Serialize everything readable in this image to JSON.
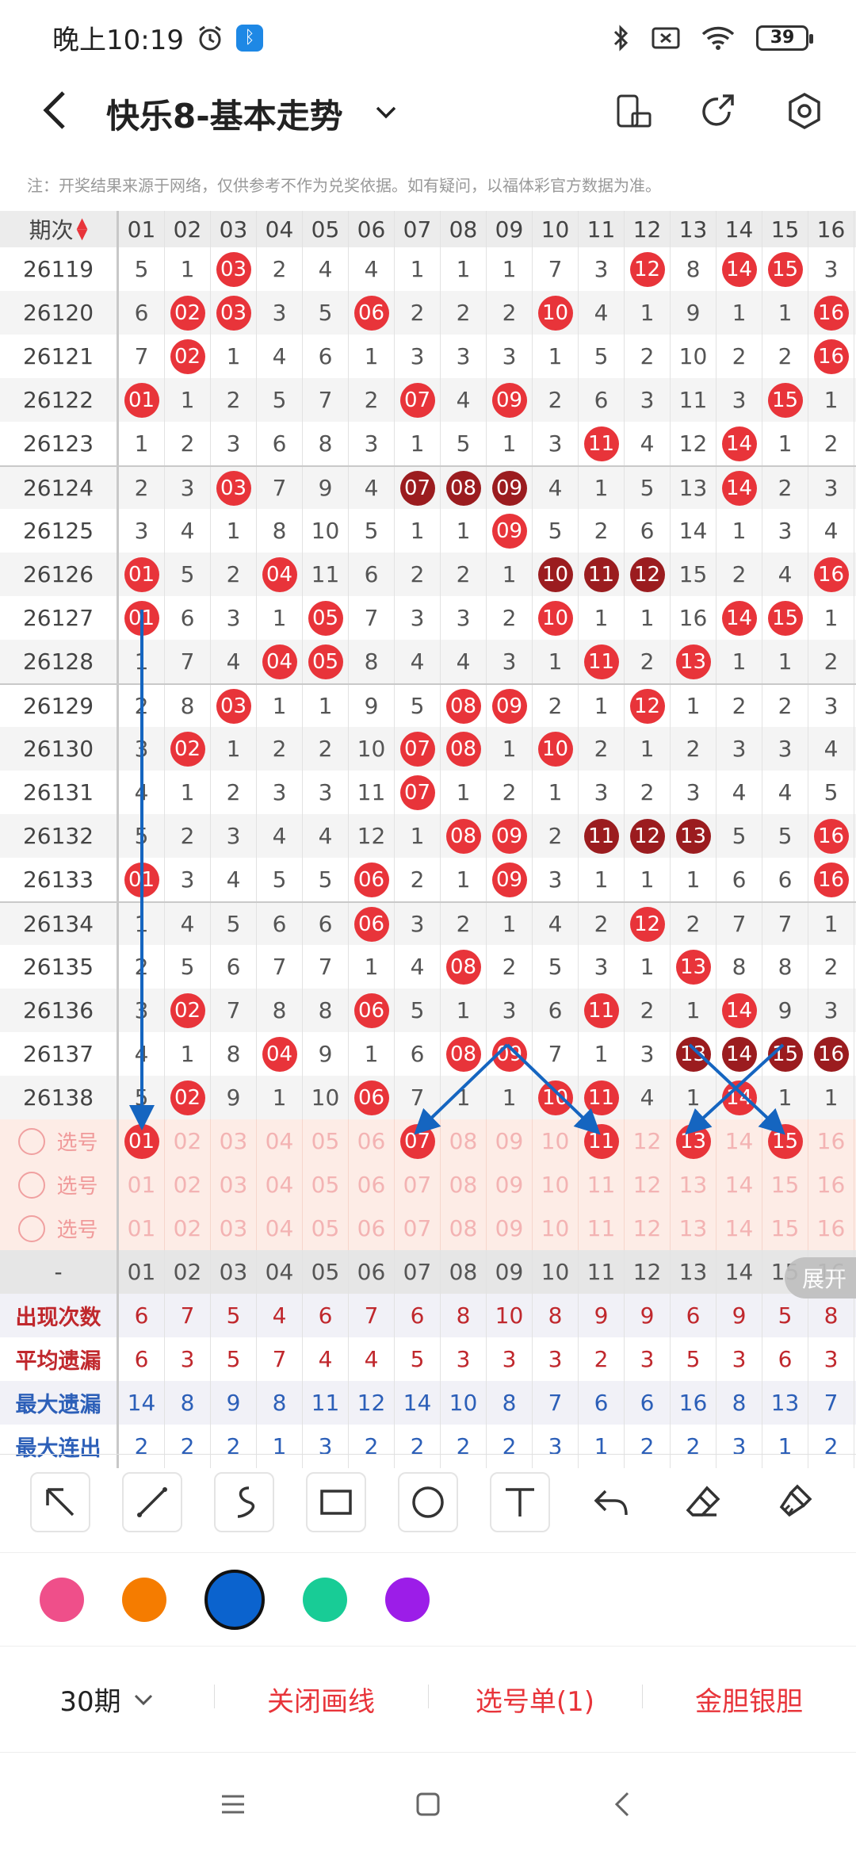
{
  "status": {
    "time": "晚上10:19",
    "battery": "39"
  },
  "header": {
    "title": "快乐8-基本走势"
  },
  "disclaimer": "注：开奖结果来源于网络，仅供参考不作为兑奖依据。如有疑问，以福体彩官方数据为准。",
  "table": {
    "period_label": "期次",
    "columns": [
      "01",
      "02",
      "03",
      "04",
      "05",
      "06",
      "07",
      "08",
      "09",
      "10",
      "11",
      "12",
      "13",
      "14",
      "15",
      "16"
    ],
    "rows": [
      {
        "period": "26119",
        "cells": [
          "5",
          "1",
          "03",
          "2",
          "4",
          "4",
          "1",
          "1",
          "1",
          "7",
          "3",
          "12",
          "8",
          "14",
          "15",
          "3"
        ],
        "hits": [
          3,
          12,
          14,
          15
        ],
        "dark": []
      },
      {
        "period": "26120",
        "cells": [
          "6",
          "02",
          "03",
          "3",
          "5",
          "06",
          "2",
          "2",
          "2",
          "10",
          "4",
          "1",
          "9",
          "1",
          "1",
          "16"
        ],
        "hits": [
          2,
          3,
          6,
          10,
          16
        ],
        "dark": []
      },
      {
        "period": "26121",
        "cells": [
          "7",
          "02",
          "1",
          "4",
          "6",
          "1",
          "3",
          "3",
          "3",
          "1",
          "5",
          "2",
          "10",
          "2",
          "2",
          "16"
        ],
        "hits": [
          2,
          16
        ],
        "dark": []
      },
      {
        "period": "26122",
        "cells": [
          "01",
          "1",
          "2",
          "5",
          "7",
          "2",
          "07",
          "4",
          "09",
          "2",
          "6",
          "3",
          "11",
          "3",
          "15",
          "1"
        ],
        "hits": [
          1,
          7,
          9,
          15
        ],
        "dark": []
      },
      {
        "period": "26123",
        "cells": [
          "1",
          "2",
          "3",
          "6",
          "8",
          "3",
          "1",
          "5",
          "1",
          "3",
          "11",
          "4",
          "12",
          "14",
          "1",
          "2"
        ],
        "hits": [
          11,
          14
        ],
        "dark": []
      },
      {
        "period": "26124",
        "cells": [
          "2",
          "3",
          "03",
          "7",
          "9",
          "4",
          "07",
          "08",
          "09",
          "4",
          "1",
          "5",
          "13",
          "14",
          "2",
          "3"
        ],
        "hits": [
          3,
          14
        ],
        "dark": [
          7,
          8,
          9
        ]
      },
      {
        "period": "26125",
        "cells": [
          "3",
          "4",
          "1",
          "8",
          "10",
          "5",
          "1",
          "1",
          "09",
          "5",
          "2",
          "6",
          "14",
          "1",
          "3",
          "4"
        ],
        "hits": [
          9
        ],
        "dark": []
      },
      {
        "period": "26126",
        "cells": [
          "01",
          "5",
          "2",
          "04",
          "11",
          "6",
          "2",
          "2",
          "1",
          "10",
          "11",
          "12",
          "15",
          "2",
          "4",
          "16"
        ],
        "hits": [
          1,
          4,
          16
        ],
        "dark": [
          10,
          11,
          12
        ]
      },
      {
        "period": "26127",
        "cells": [
          "01",
          "6",
          "3",
          "1",
          "05",
          "7",
          "3",
          "3",
          "2",
          "10",
          "1",
          "1",
          "16",
          "14",
          "15",
          "1"
        ],
        "hits": [
          1,
          5,
          10,
          14,
          15
        ],
        "dark": []
      },
      {
        "period": "26128",
        "cells": [
          "1",
          "7",
          "4",
          "04",
          "05",
          "8",
          "4",
          "4",
          "3",
          "1",
          "11",
          "2",
          "13",
          "1",
          "1",
          "2"
        ],
        "hits": [
          4,
          5,
          11,
          13
        ],
        "dark": []
      },
      {
        "period": "26129",
        "cells": [
          "2",
          "8",
          "03",
          "1",
          "1",
          "9",
          "5",
          "08",
          "09",
          "2",
          "1",
          "12",
          "1",
          "2",
          "2",
          "3"
        ],
        "hits": [
          3,
          8,
          9,
          12
        ],
        "dark": []
      },
      {
        "period": "26130",
        "cells": [
          "3",
          "02",
          "1",
          "2",
          "2",
          "10",
          "07",
          "08",
          "1",
          "10",
          "2",
          "1",
          "2",
          "3",
          "3",
          "4"
        ],
        "hits": [
          2,
          7,
          8,
          10
        ],
        "dark": []
      },
      {
        "period": "26131",
        "cells": [
          "4",
          "1",
          "2",
          "3",
          "3",
          "11",
          "07",
          "1",
          "2",
          "1",
          "3",
          "2",
          "3",
          "4",
          "4",
          "5"
        ],
        "hits": [
          7
        ],
        "dark": []
      },
      {
        "period": "26132",
        "cells": [
          "5",
          "2",
          "3",
          "4",
          "4",
          "12",
          "1",
          "08",
          "09",
          "2",
          "11",
          "12",
          "13",
          "5",
          "5",
          "16"
        ],
        "hits": [
          8,
          9,
          16
        ],
        "dark": [
          11,
          12,
          13
        ]
      },
      {
        "period": "26133",
        "cells": [
          "01",
          "3",
          "4",
          "5",
          "5",
          "06",
          "2",
          "1",
          "09",
          "3",
          "1",
          "1",
          "1",
          "6",
          "6",
          "16"
        ],
        "hits": [
          1,
          6,
          9,
          16
        ],
        "dark": []
      },
      {
        "period": "26134",
        "cells": [
          "1",
          "4",
          "5",
          "6",
          "6",
          "06",
          "3",
          "2",
          "1",
          "4",
          "2",
          "12",
          "2",
          "7",
          "7",
          "1"
        ],
        "hits": [
          6,
          12
        ],
        "dark": []
      },
      {
        "period": "26135",
        "cells": [
          "2",
          "5",
          "6",
          "7",
          "7",
          "1",
          "4",
          "08",
          "2",
          "5",
          "3",
          "1",
          "13",
          "8",
          "8",
          "2"
        ],
        "hits": [
          8,
          13
        ],
        "dark": []
      },
      {
        "period": "26136",
        "cells": [
          "3",
          "02",
          "7",
          "8",
          "8",
          "06",
          "5",
          "1",
          "3",
          "6",
          "11",
          "2",
          "1",
          "14",
          "9",
          "3"
        ],
        "hits": [
          2,
          6,
          11,
          14
        ],
        "dark": []
      },
      {
        "period": "26137",
        "cells": [
          "4",
          "1",
          "8",
          "04",
          "9",
          "1",
          "6",
          "08",
          "09",
          "7",
          "1",
          "3",
          "13",
          "14",
          "15",
          "16"
        ],
        "hits": [
          4,
          8,
          9
        ],
        "dark": [
          13,
          14,
          15,
          16
        ]
      },
      {
        "period": "26138",
        "cells": [
          "5",
          "02",
          "9",
          "1",
          "10",
          "06",
          "7",
          "1",
          "1",
          "10",
          "11",
          "4",
          "1",
          "14",
          "1",
          "1"
        ],
        "hits": [
          2,
          6,
          10,
          11,
          14
        ],
        "dark": []
      }
    ],
    "pick_label": "选号",
    "pick_rows": [
      {
        "selected": [
          1,
          7,
          11,
          13,
          15
        ]
      },
      {
        "selected": []
      },
      {
        "selected": []
      }
    ],
    "stats_header": "-",
    "stats": [
      {
        "label": "出现次数",
        "values": [
          "6",
          "7",
          "5",
          "4",
          "6",
          "7",
          "6",
          "8",
          "10",
          "8",
          "9",
          "9",
          "6",
          "9",
          "5",
          "8"
        ],
        "color": "red"
      },
      {
        "label": "平均遗漏",
        "values": [
          "6",
          "3",
          "5",
          "7",
          "4",
          "4",
          "5",
          "3",
          "3",
          "3",
          "2",
          "3",
          "5",
          "3",
          "6",
          "3"
        ],
        "color": "red"
      },
      {
        "label": "最大遗漏",
        "values": [
          "14",
          "8",
          "9",
          "8",
          "11",
          "12",
          "14",
          "10",
          "8",
          "7",
          "6",
          "6",
          "16",
          "8",
          "13",
          "7"
        ],
        "color": "blue"
      },
      {
        "label": "最大连出",
        "values": [
          "2",
          "2",
          "2",
          "1",
          "3",
          "2",
          "2",
          "2",
          "2",
          "3",
          "1",
          "2",
          "2",
          "3",
          "1",
          "2"
        ],
        "color": "blue"
      }
    ],
    "expand_label": "展开"
  },
  "toolbar": {
    "icons": [
      "arrow-tool-icon",
      "line-tool-icon",
      "curve-tool-icon",
      "rectangle-tool-icon",
      "circle-tool-icon",
      "text-tool-icon",
      "undo-icon",
      "eraser-icon",
      "clear-brush-icon"
    ]
  },
  "colors": [
    "#ef4f8a",
    "#f57c00",
    "#0b63ce",
    "#18cc96",
    "#9c1de8"
  ],
  "selected_color": "#0b63ce",
  "bottom": {
    "period_select": "30期",
    "close_lines": "关闭画线",
    "pick_list": "选号单(1)",
    "gold_silver": "金胆银胆"
  }
}
